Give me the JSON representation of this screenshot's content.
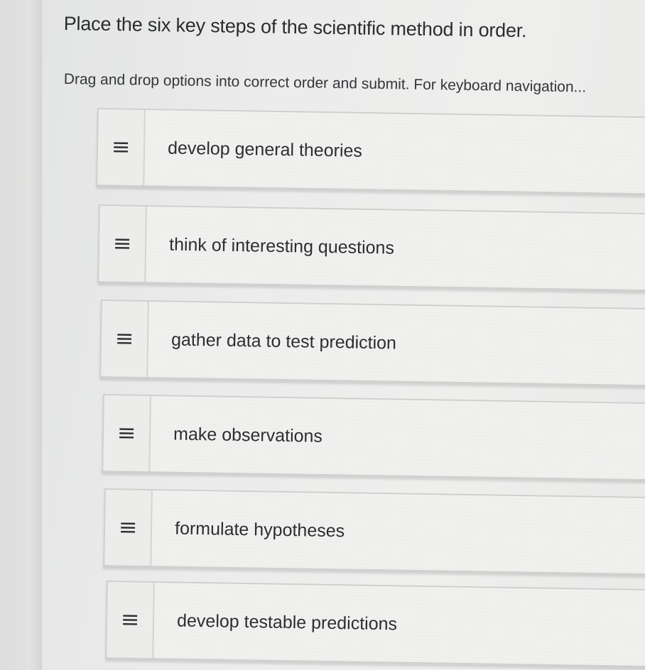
{
  "question": {
    "title": "Place the six key steps of the scientific method in order.",
    "instructions": "Drag and drop options into correct order and submit. For keyboard navigation..."
  },
  "options": [
    {
      "label": "develop general theories",
      "handle_icon": "drag-handle-icon"
    },
    {
      "label": "think of interesting questions",
      "handle_icon": "drag-handle-icon"
    },
    {
      "label": "gather data to test prediction",
      "handle_icon": "drag-handle-icon"
    },
    {
      "label": "make observations",
      "handle_icon": "drag-handle-icon"
    },
    {
      "label": "formulate hypotheses",
      "handle_icon": "drag-handle-icon"
    },
    {
      "label": "develop testable predictions",
      "handle_icon": "drag-handle-icon"
    }
  ]
}
